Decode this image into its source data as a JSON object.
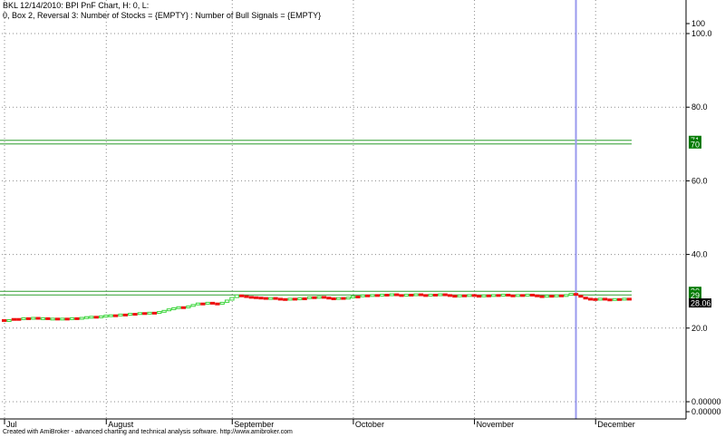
{
  "header": {
    "line1": "BKL 12/14/2010: BPI PnF Chart, H: 0, L:",
    "line2": "0, Box 2, Reversal 3: Number of Stocks = {EMPTY} : Number of Bull Signals = {EMPTY}"
  },
  "footer": "Created with AmiBroker - advanced charting and technical analysis software. http://www.amibroker.com",
  "colors": {
    "level_line": "#2e9e2e",
    "level_badge": "#007a00",
    "cursor_line": "#9999ee",
    "candle_up": "#3bd43b",
    "candle_down": "#ee1111",
    "price_badge": "#000000",
    "grid": "#8a8a8a"
  },
  "chart_data": {
    "type": "candlestick",
    "ylim": [
      0,
      100
    ],
    "y_ticks": [
      {
        "value": 0,
        "label": "0.00000"
      },
      {
        "value": 20,
        "label": "20.0"
      },
      {
        "value": 40,
        "label": "40.0"
      },
      {
        "value": 60,
        "label": "60.0"
      },
      {
        "value": 80,
        "label": "80.0"
      },
      {
        "value": 100,
        "label": "100.0"
      },
      {
        "value": 100,
        "label": "100"
      },
      {
        "value": 0,
        "label": "0.00000"
      }
    ],
    "x_ticks": [
      "Jul",
      "August",
      "September",
      "October",
      "November",
      "December"
    ],
    "horizontal_levels": [
      {
        "value": 71,
        "label": "71"
      },
      {
        "value": 70,
        "label": "70"
      },
      {
        "value": 30,
        "label": "30"
      },
      {
        "value": 29,
        "label": "29"
      }
    ],
    "last_price": {
      "value": 28.06,
      "label": "28.06"
    },
    "cursor_index": 118,
    "bars": [
      {
        "o": 22.0,
        "c": 22.3,
        "dir": "down"
      },
      {
        "o": 22.3,
        "c": 22.0,
        "dir": "up"
      },
      {
        "o": 22.4,
        "c": 22.6,
        "dir": "down"
      },
      {
        "o": 22.6,
        "c": 22.4,
        "dir": "down"
      },
      {
        "o": 22.6,
        "c": 22.8,
        "dir": "up"
      },
      {
        "o": 22.8,
        "c": 22.6,
        "dir": "down"
      },
      {
        "o": 22.7,
        "c": 22.9,
        "dir": "up"
      },
      {
        "o": 22.9,
        "c": 22.7,
        "dir": "down"
      },
      {
        "o": 22.6,
        "c": 22.8,
        "dir": "up"
      },
      {
        "o": 22.8,
        "c": 22.5,
        "dir": "down"
      },
      {
        "o": 22.5,
        "c": 22.7,
        "dir": "up"
      },
      {
        "o": 22.7,
        "c": 22.4,
        "dir": "down"
      },
      {
        "o": 22.5,
        "c": 22.7,
        "dir": "up"
      },
      {
        "o": 22.7,
        "c": 22.5,
        "dir": "down"
      },
      {
        "o": 22.6,
        "c": 22.8,
        "dir": "up"
      },
      {
        "o": 22.8,
        "c": 22.6,
        "dir": "down"
      },
      {
        "o": 22.7,
        "c": 22.9,
        "dir": "up"
      },
      {
        "o": 22.9,
        "c": 23.1,
        "dir": "up"
      },
      {
        "o": 23.0,
        "c": 23.2,
        "dir": "up"
      },
      {
        "o": 23.2,
        "c": 23.0,
        "dir": "down"
      },
      {
        "o": 23.1,
        "c": 23.3,
        "dir": "up"
      },
      {
        "o": 23.3,
        "c": 23.5,
        "dir": "up"
      },
      {
        "o": 23.4,
        "c": 23.6,
        "dir": "up"
      },
      {
        "o": 23.6,
        "c": 23.4,
        "dir": "down"
      },
      {
        "o": 23.5,
        "c": 23.8,
        "dir": "up"
      },
      {
        "o": 23.8,
        "c": 23.6,
        "dir": "down"
      },
      {
        "o": 23.7,
        "c": 24.0,
        "dir": "up"
      },
      {
        "o": 24.0,
        "c": 23.8,
        "dir": "down"
      },
      {
        "o": 23.9,
        "c": 24.2,
        "dir": "up"
      },
      {
        "o": 24.2,
        "c": 24.0,
        "dir": "down"
      },
      {
        "o": 24.0,
        "c": 24.3,
        "dir": "up"
      },
      {
        "o": 24.3,
        "c": 24.1,
        "dir": "down"
      },
      {
        "o": 24.2,
        "c": 24.5,
        "dir": "up"
      },
      {
        "o": 24.5,
        "c": 24.8,
        "dir": "up"
      },
      {
        "o": 24.8,
        "c": 25.2,
        "dir": "up"
      },
      {
        "o": 25.2,
        "c": 25.5,
        "dir": "up"
      },
      {
        "o": 25.4,
        "c": 25.8,
        "dir": "up"
      },
      {
        "o": 25.8,
        "c": 25.6,
        "dir": "down"
      },
      {
        "o": 25.7,
        "c": 26.0,
        "dir": "up"
      },
      {
        "o": 26.0,
        "c": 26.4,
        "dir": "up"
      },
      {
        "o": 26.4,
        "c": 26.8,
        "dir": "up"
      },
      {
        "o": 26.8,
        "c": 26.5,
        "dir": "down"
      },
      {
        "o": 26.6,
        "c": 27.0,
        "dir": "up"
      },
      {
        "o": 27.0,
        "c": 26.8,
        "dir": "down"
      },
      {
        "o": 26.8,
        "c": 26.5,
        "dir": "down"
      },
      {
        "o": 26.6,
        "c": 27.0,
        "dir": "up"
      },
      {
        "o": 27.0,
        "c": 27.6,
        "dir": "up"
      },
      {
        "o": 27.6,
        "c": 28.3,
        "dir": "up"
      },
      {
        "o": 28.3,
        "c": 29.0,
        "dir": "up"
      },
      {
        "o": 29.0,
        "c": 28.7,
        "dir": "down"
      },
      {
        "o": 28.8,
        "c": 28.5,
        "dir": "down"
      },
      {
        "o": 28.6,
        "c": 28.4,
        "dir": "down"
      },
      {
        "o": 28.5,
        "c": 28.3,
        "dir": "down"
      },
      {
        "o": 28.4,
        "c": 28.2,
        "dir": "down"
      },
      {
        "o": 28.3,
        "c": 28.0,
        "dir": "down"
      },
      {
        "o": 28.1,
        "c": 28.3,
        "dir": "up"
      },
      {
        "o": 28.3,
        "c": 28.0,
        "dir": "down"
      },
      {
        "o": 28.1,
        "c": 27.9,
        "dir": "down"
      },
      {
        "o": 28.0,
        "c": 27.8,
        "dir": "down"
      },
      {
        "o": 27.9,
        "c": 28.1,
        "dir": "up"
      },
      {
        "o": 28.1,
        "c": 27.8,
        "dir": "down"
      },
      {
        "o": 27.9,
        "c": 28.2,
        "dir": "up"
      },
      {
        "o": 28.2,
        "c": 28.0,
        "dir": "down"
      },
      {
        "o": 28.1,
        "c": 28.5,
        "dir": "up"
      },
      {
        "o": 28.5,
        "c": 28.2,
        "dir": "down"
      },
      {
        "o": 28.3,
        "c": 28.6,
        "dir": "up"
      },
      {
        "o": 28.6,
        "c": 28.3,
        "dir": "down"
      },
      {
        "o": 28.4,
        "c": 28.1,
        "dir": "down"
      },
      {
        "o": 28.2,
        "c": 27.9,
        "dir": "down"
      },
      {
        "o": 28.0,
        "c": 28.3,
        "dir": "up"
      },
      {
        "o": 28.3,
        "c": 28.0,
        "dir": "down"
      },
      {
        "o": 28.1,
        "c": 28.4,
        "dir": "up"
      },
      {
        "o": 28.4,
        "c": 28.7,
        "dir": "up"
      },
      {
        "o": 28.7,
        "c": 28.5,
        "dir": "down"
      },
      {
        "o": 28.6,
        "c": 29.0,
        "dir": "up"
      },
      {
        "o": 29.0,
        "c": 28.7,
        "dir": "down"
      },
      {
        "o": 28.8,
        "c": 29.1,
        "dir": "up"
      },
      {
        "o": 29.1,
        "c": 28.8,
        "dir": "down"
      },
      {
        "o": 28.9,
        "c": 29.2,
        "dir": "up"
      },
      {
        "o": 29.2,
        "c": 28.9,
        "dir": "down"
      },
      {
        "o": 29.0,
        "c": 29.3,
        "dir": "up"
      },
      {
        "o": 29.3,
        "c": 29.0,
        "dir": "down"
      },
      {
        "o": 29.1,
        "c": 28.8,
        "dir": "down"
      },
      {
        "o": 28.9,
        "c": 29.2,
        "dir": "up"
      },
      {
        "o": 29.2,
        "c": 28.9,
        "dir": "down"
      },
      {
        "o": 29.0,
        "c": 29.3,
        "dir": "up"
      },
      {
        "o": 29.3,
        "c": 29.0,
        "dir": "down"
      },
      {
        "o": 29.1,
        "c": 28.8,
        "dir": "down"
      },
      {
        "o": 28.9,
        "c": 29.2,
        "dir": "up"
      },
      {
        "o": 29.2,
        "c": 28.9,
        "dir": "down"
      },
      {
        "o": 29.0,
        "c": 29.3,
        "dir": "up"
      },
      {
        "o": 29.3,
        "c": 29.0,
        "dir": "down"
      },
      {
        "o": 29.1,
        "c": 28.8,
        "dir": "down"
      },
      {
        "o": 28.9,
        "c": 28.6,
        "dir": "down"
      },
      {
        "o": 28.7,
        "c": 29.0,
        "dir": "up"
      },
      {
        "o": 29.0,
        "c": 28.7,
        "dir": "down"
      },
      {
        "o": 28.8,
        "c": 29.1,
        "dir": "up"
      },
      {
        "o": 29.1,
        "c": 28.8,
        "dir": "down"
      },
      {
        "o": 28.9,
        "c": 28.6,
        "dir": "down"
      },
      {
        "o": 28.7,
        "c": 29.0,
        "dir": "up"
      },
      {
        "o": 29.0,
        "c": 28.7,
        "dir": "down"
      },
      {
        "o": 28.8,
        "c": 29.1,
        "dir": "up"
      },
      {
        "o": 29.1,
        "c": 28.8,
        "dir": "down"
      },
      {
        "o": 28.9,
        "c": 29.2,
        "dir": "up"
      },
      {
        "o": 29.2,
        "c": 28.9,
        "dir": "down"
      },
      {
        "o": 29.0,
        "c": 28.7,
        "dir": "down"
      },
      {
        "o": 28.8,
        "c": 29.1,
        "dir": "up"
      },
      {
        "o": 29.1,
        "c": 28.8,
        "dir": "down"
      },
      {
        "o": 28.9,
        "c": 29.2,
        "dir": "up"
      },
      {
        "o": 29.2,
        "c": 28.9,
        "dir": "down"
      },
      {
        "o": 29.0,
        "c": 28.7,
        "dir": "down"
      },
      {
        "o": 28.8,
        "c": 28.5,
        "dir": "down"
      },
      {
        "o": 28.6,
        "c": 28.9,
        "dir": "up"
      },
      {
        "o": 28.9,
        "c": 28.6,
        "dir": "down"
      },
      {
        "o": 28.7,
        "c": 29.0,
        "dir": "up"
      },
      {
        "o": 29.0,
        "c": 28.7,
        "dir": "down"
      },
      {
        "o": 28.8,
        "c": 29.1,
        "dir": "up"
      },
      {
        "o": 29.1,
        "c": 29.4,
        "dir": "up"
      },
      {
        "o": 29.4,
        "c": 28.9,
        "dir": "down"
      },
      {
        "o": 28.9,
        "c": 28.4,
        "dir": "down"
      },
      {
        "o": 28.4,
        "c": 28.1,
        "dir": "down"
      },
      {
        "o": 28.1,
        "c": 27.9,
        "dir": "down"
      },
      {
        "o": 28.0,
        "c": 27.8,
        "dir": "down"
      },
      {
        "o": 27.9,
        "c": 28.1,
        "dir": "up"
      },
      {
        "o": 28.1,
        "c": 27.8,
        "dir": "down"
      },
      {
        "o": 27.9,
        "c": 27.7,
        "dir": "down"
      },
      {
        "o": 27.8,
        "c": 28.0,
        "dir": "up"
      },
      {
        "o": 28.0,
        "c": 27.8,
        "dir": "down"
      },
      {
        "o": 27.9,
        "c": 28.1,
        "dir": "up"
      },
      {
        "o": 28.1,
        "c": 28.06,
        "dir": "down"
      }
    ]
  }
}
